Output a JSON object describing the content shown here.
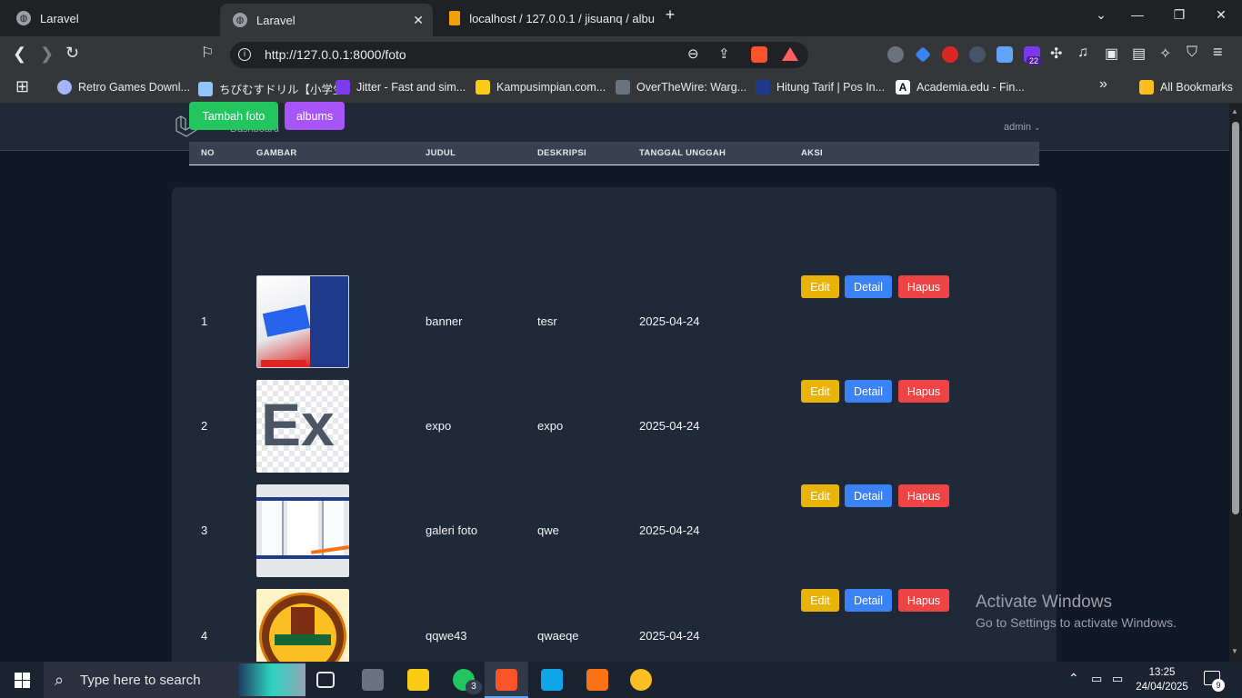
{
  "browser": {
    "tabs": [
      {
        "title": "Laravel"
      },
      {
        "title": "Laravel"
      },
      {
        "title": "localhost / 127.0.0.1 / jisuanq / albu"
      }
    ],
    "url": "http://127.0.0.1:8000/foto",
    "extension_badge": "22",
    "bookmarks": [
      "Retro Games Downl...",
      "ちびむすドリル【小学生】",
      "Jitter - Fast and sim...",
      "Kampusimpian.com...",
      "OverTheWire: Warg...",
      "Hitung Tarif | Pos In...",
      "Academia.edu - Fin..."
    ],
    "all_bookmarks": "All Bookmarks"
  },
  "app": {
    "nav_link": "Dashboard",
    "user": "admin",
    "buttons": {
      "add": "Tambah foto",
      "albums": "albums"
    },
    "columns": [
      "NO",
      "GAMBAR",
      "JUDUL",
      "DESKRIPSI",
      "TANGGAL UNGGAH",
      "AKSI"
    ],
    "actions": {
      "edit": "Edit",
      "detail": "Detail",
      "delete": "Hapus"
    },
    "rows": [
      {
        "no": "1",
        "judul": "banner",
        "deskripsi": "tesr",
        "tanggal": "2025-04-24"
      },
      {
        "no": "2",
        "judul": "expo",
        "deskripsi": "expo",
        "tanggal": "2025-04-24"
      },
      {
        "no": "3",
        "judul": "galeri foto",
        "deskripsi": "qwe",
        "tanggal": "2025-04-24"
      },
      {
        "no": "4",
        "judul": "qqwe43",
        "deskripsi": "qwaeqe",
        "tanggal": "2025-04-24"
      }
    ],
    "thumb_text": {
      "expo": "Ex"
    }
  },
  "watermark": {
    "line1": "Activate Windows",
    "line2": "Go to Settings to activate Windows."
  },
  "taskbar": {
    "search_placeholder": "Type here to search",
    "whatsapp_badge": "3",
    "time": "13:25",
    "date": "24/04/2025",
    "notifications": "9"
  },
  "colors": {
    "add": "#22c55e",
    "albums": "#a855f7",
    "edit": "#eab308",
    "detail": "#3b82f6",
    "delete": "#ef4444"
  }
}
